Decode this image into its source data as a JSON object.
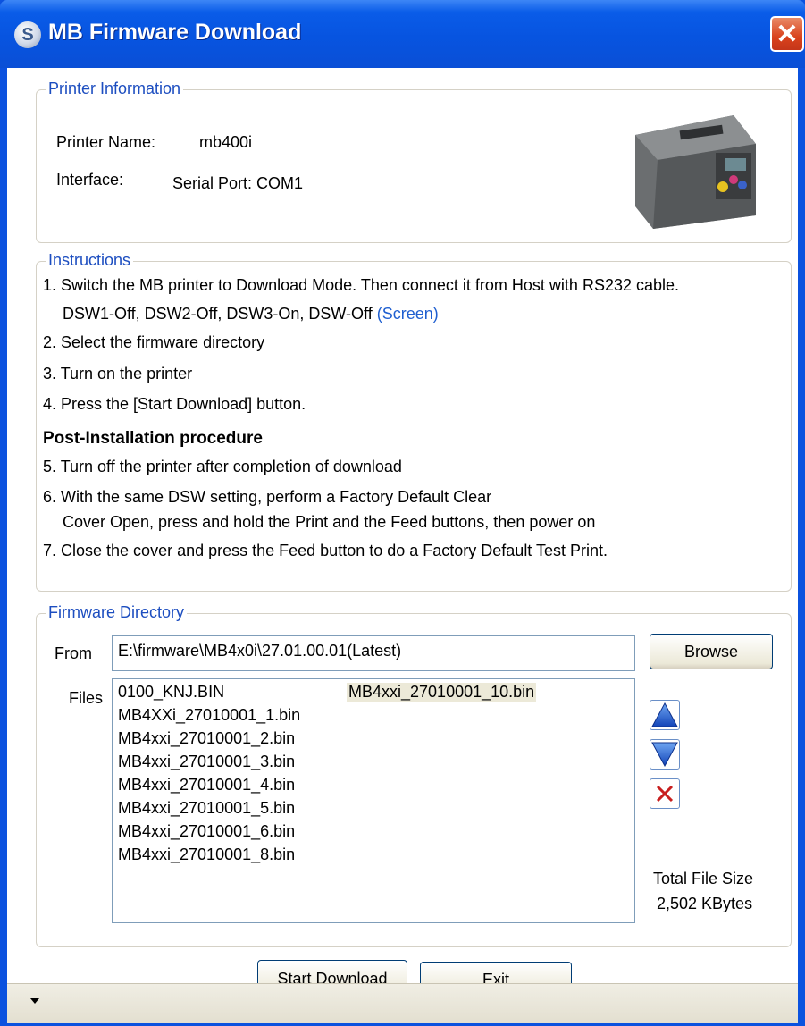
{
  "window": {
    "title": "MB Firmware Download",
    "close_glyph": "✕"
  },
  "printer_info": {
    "legend": "Printer Information",
    "name_label": "Printer Name:",
    "name_value": "mb400i",
    "interface_label": "Interface:",
    "interface_value": "Serial Port: COM1"
  },
  "instructions": {
    "legend": "Instructions",
    "step1_line1": "1. Switch the MB printer to Download Mode.  Then connect it from Host with RS232 cable.",
    "step1_line2": "DSW1-Off, DSW2-Off, DSW3-On, DSW-Off",
    "screen_link": "(Screen)",
    "step2": "2. Select the firmware directory",
    "step3": "3. Turn on the printer",
    "step4": "4. Press the [Start Download] button.",
    "post_heading": "Post-Installation procedure",
    "step5": "5. Turn off the printer after completion of download",
    "step6_line1": "6. With the same DSW setting, perform a Factory Default Clear",
    "step6_line2": "Cover Open, press and hold the Print and the Feed buttons, then power on",
    "step7": "7. Close the cover and press the Feed button to do a Factory Default Test Print."
  },
  "firmware": {
    "legend": "Firmware Directory",
    "from_label": "From",
    "from_value": "E:\\firmware\\MB4x0i\\27.01.00.01(Latest)",
    "browse_label": "Browse",
    "files_label": "Files",
    "files_col1": [
      "0100_KNJ.BIN",
      "MB4XXi_27010001_1.bin",
      "MB4xxi_27010001_2.bin",
      "MB4xxi_27010001_3.bin",
      "MB4xxi_27010001_4.bin",
      "MB4xxi_27010001_5.bin",
      "MB4xxi_27010001_6.bin",
      "MB4xxi_27010001_8.bin"
    ],
    "files_col2": [
      "MB4xxi_27010001_10.bin"
    ],
    "total_label": "Total File Size",
    "total_value": "2,502 KBytes"
  },
  "buttons": {
    "start": "Start Download",
    "exit": "Exit"
  },
  "icons": {
    "up": "arrow-up-icon",
    "down": "arrow-down-icon",
    "delete": "delete-x-icon"
  },
  "colors": {
    "title_bar": "#0754e0",
    "legend": "#1d4ec0",
    "link": "#1f5fd0",
    "close": "#d9421c"
  }
}
